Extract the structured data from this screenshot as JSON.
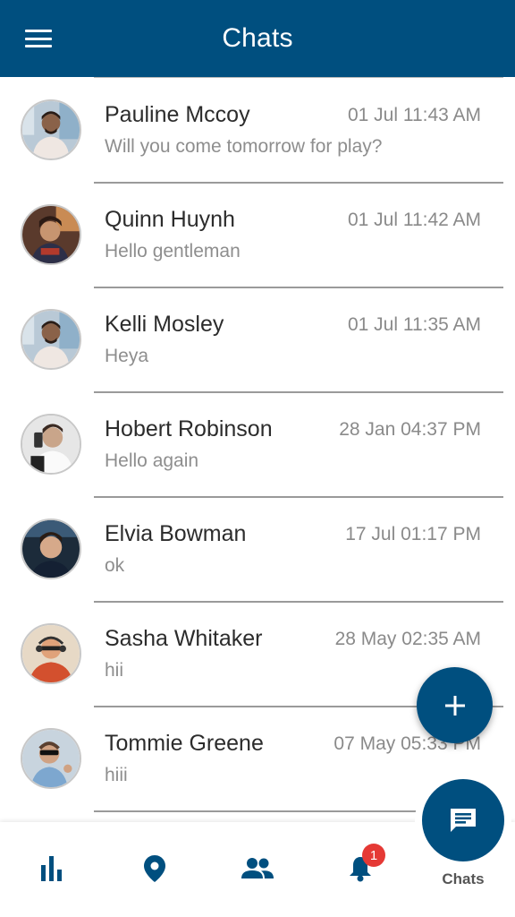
{
  "appbar": {
    "title": "Chats",
    "menu_icon": "menu-icon"
  },
  "chats": [
    {
      "name": "Pauline Mccoy",
      "time": "01 Jul 11:43 AM",
      "message": "Will you come tomorrow for play?"
    },
    {
      "name": "Quinn Huynh",
      "time": "01 Jul 11:42 AM",
      "message": "Hello gentleman"
    },
    {
      "name": "Kelli Mosley",
      "time": "01 Jul 11:35 AM",
      "message": "Heya"
    },
    {
      "name": "Hobert Robinson",
      "time": "28 Jan 04:37 PM",
      "message": "Hello again"
    },
    {
      "name": "Elvia Bowman",
      "time": "17 Jul 01:17 PM",
      "message": "ok"
    },
    {
      "name": "Sasha Whitaker",
      "time": "28 May 02:35 AM",
      "message": "hii"
    },
    {
      "name": "Tommie Greene",
      "time": "07 May 05:33 PM",
      "message": "hiii"
    }
  ],
  "fab": {
    "icon": "plus-icon"
  },
  "bottom_nav": {
    "items": [
      {
        "icon": "bar-chart-icon"
      },
      {
        "icon": "location-pin-icon"
      },
      {
        "icon": "people-icon"
      },
      {
        "icon": "bell-icon",
        "badge": "1"
      }
    ],
    "active": {
      "icon": "chat-bubble-icon",
      "label": "Chats"
    }
  },
  "colors": {
    "primary": "#004f7f",
    "badge": "#e53935"
  }
}
